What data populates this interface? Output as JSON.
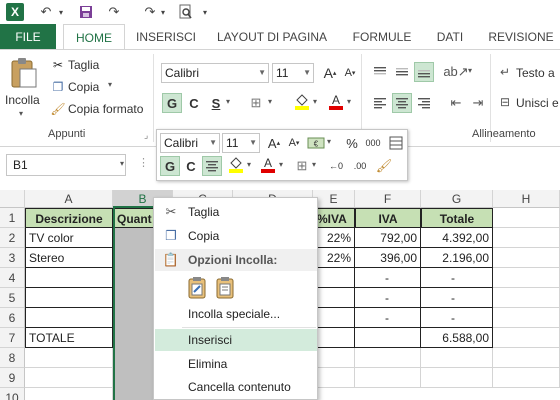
{
  "quick_access": {
    "app_icon": "X",
    "icons": [
      "undo-icon",
      "save-icon",
      "redo-icon",
      "print-preview-icon"
    ]
  },
  "tabs": [
    "FILE",
    "HOME",
    "INSERISCI",
    "LAYOUT DI PAGINA",
    "FORMULE",
    "DATI",
    "REVISIONE"
  ],
  "ribbon": {
    "clipboard": {
      "paste_label": "Incolla",
      "cut_label": "Taglia",
      "copy_label": "Copia",
      "format_painter_label": "Copia formato",
      "group_label": "Appunti"
    },
    "font": {
      "font_name": "Calibri",
      "font_size": "11",
      "grow": "A",
      "shrink": "A",
      "bold": "G",
      "italic": "C",
      "underline": "S"
    },
    "alignment": {
      "group_label": "Allineamento"
    },
    "wrap": {
      "wrap_text_label": "Testo a",
      "merge_label": "Unisci e"
    }
  },
  "formula_bar": {
    "name_box": "B1"
  },
  "mini_toolbar": {
    "font_name": "Calibri",
    "font_size": "11",
    "grow": "A",
    "shrink": "A",
    "currency": "€",
    "percent": "%",
    "thousands": "000",
    "bold": "G",
    "italic": "C",
    "font_color_letter": "A"
  },
  "columns": [
    "A",
    "B",
    "C",
    "D",
    "E",
    "F",
    "G",
    "H"
  ],
  "rows": [
    "1",
    "2",
    "3",
    "4",
    "5",
    "6",
    "7",
    "8",
    "9",
    "10"
  ],
  "table": {
    "headers": {
      "A": "Descrizione",
      "B": "Quant",
      "E": "%IVA",
      "F": "IVA",
      "G": "Totale"
    },
    "rows": [
      {
        "A": "TV color",
        "E": "22%",
        "F": "792,00",
        "G": "4.392,00"
      },
      {
        "A": "Stereo",
        "E": "22%",
        "F": "396,00",
        "G": "2.196,00"
      },
      {
        "A": "",
        "F": "-",
        "G": "-"
      },
      {
        "A": "",
        "F": "-",
        "G": "-"
      },
      {
        "A": "",
        "F": "-",
        "G": "-"
      },
      {
        "A": "TOTALE",
        "F": "",
        "G": "6.588,00"
      }
    ]
  },
  "context_menu": {
    "cut": "Taglia",
    "copy": "Copia",
    "paste_options_heading": "Opzioni Incolla:",
    "paste_special": "Incolla speciale...",
    "insert": "Inserisci",
    "delete": "Elimina",
    "clear_contents": "Cancella contenuto"
  },
  "colors": {
    "accent": "#217346",
    "header_fill": "#c6e0b4",
    "selected_column": "#bfbfbf",
    "menu_highlight": "#d3ebdc",
    "font_color_bar": "#e00000",
    "highlight_color_bar": "#ffff00"
  }
}
